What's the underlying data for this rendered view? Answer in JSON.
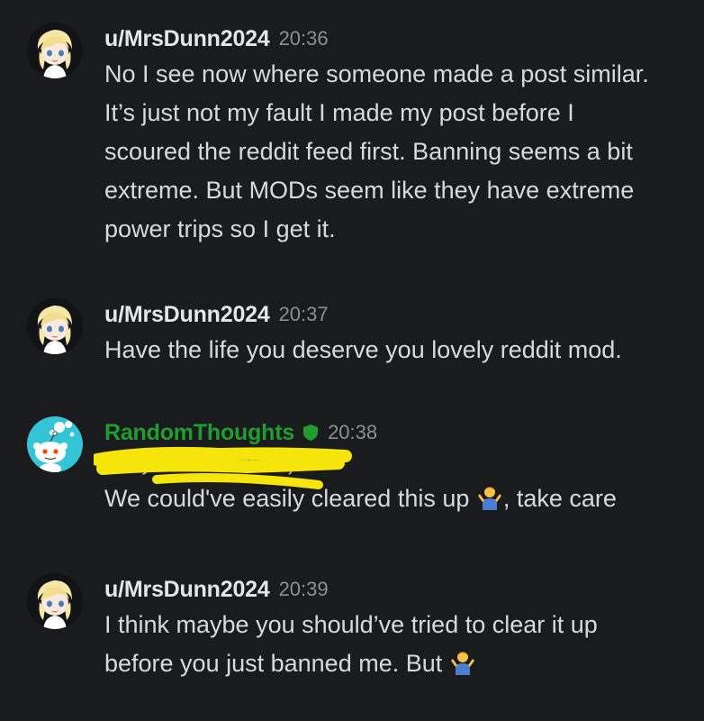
{
  "messages": [
    {
      "username": "u/MrsDunn2024",
      "time": "20:36",
      "text": "No I see now where someone made a post similar. It’s just not my fault I made my post before I scoured the reddit feed first. Banning seems a bit extreme. But MODs seem like they have extreme power trips so I get it."
    },
    {
      "username": "u/MrsDunn2024",
      "time": "20:37",
      "text": "Have the life you deserve you lovely reddit mod."
    },
    {
      "username": "RandomThoughts",
      "time": "20:38",
      "note": "(Only visible to mods)",
      "text_before_emoji": "We could've easily cleared this up ",
      "text_after_emoji": ", take care"
    },
    {
      "username": "u/MrsDunn2024",
      "time": "20:39",
      "text_before_emoji": "I think maybe you should’ve tried to clear it up before you just banned me. But "
    }
  ],
  "colors": {
    "background": "#1a1b1d",
    "mod_username": "#1f9d2e",
    "redaction": "#f5e50a",
    "timestamp": "#8b8f93"
  },
  "icons": {
    "user_avatar": "anime-girl-avatar",
    "mod_avatar": "reddit-snoo-thinking-avatar",
    "mod_badge": "shield-icon",
    "emoji": "person-shrugging-emoji"
  }
}
